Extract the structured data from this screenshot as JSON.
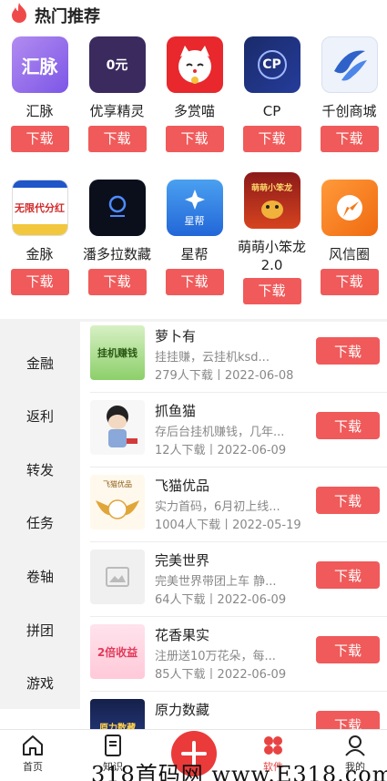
{
  "header": {
    "title": "热门推荐"
  },
  "apps": [
    {
      "name": "汇脉",
      "button": "下载",
      "icon_text": "汇脉"
    },
    {
      "name": "优享精灵",
      "button": "下载",
      "icon_text": "0元"
    },
    {
      "name": "多赏喵",
      "button": "下载",
      "icon_text": ""
    },
    {
      "name": "CP",
      "button": "下载",
      "icon_text": "CP"
    },
    {
      "name": "千创商城",
      "button": "下载",
      "icon_text": ""
    },
    {
      "name": "金脉",
      "button": "下载",
      "icon_text": "无限代分红"
    },
    {
      "name": "潘多拉数藏",
      "button": "下载",
      "icon_text": ""
    },
    {
      "name": "星帮",
      "button": "下载",
      "icon_text": "星帮"
    },
    {
      "name": "萌萌小笨龙2.0",
      "button": "下载",
      "icon_text": "萌萌小笨龙"
    },
    {
      "name": "风信圈",
      "button": "下载",
      "icon_text": ""
    }
  ],
  "side_nav": [
    "金融",
    "返利",
    "转发",
    "任务",
    "卷轴",
    "拼团",
    "游戏"
  ],
  "list": [
    {
      "title": "萝卜有",
      "desc": "挂挂赚，云挂机ksd...",
      "meta": "279人下载丨2022-06-08",
      "button": "下载",
      "thumb_text": "挂机赚钱"
    },
    {
      "title": "抓鱼猫",
      "desc": "存后台挂机赚钱，几年...",
      "meta": "12人下载丨2022-06-09",
      "button": "下载",
      "thumb_text": ""
    },
    {
      "title": "飞猫优品",
      "desc": "实力首码，6月初上线...",
      "meta": "1004人下载丨2022-05-19",
      "button": "下载",
      "thumb_text": "飞猫优品"
    },
    {
      "title": "完美世界",
      "desc": "完美世界带团上车 静...",
      "meta": "64人下载丨2022-06-09",
      "button": "下载",
      "thumb_text": ""
    },
    {
      "title": "花香果实",
      "desc": "注册送10万花朵，每...",
      "meta": "85人下载丨2022-06-09",
      "button": "下载",
      "thumb_text": "2倍收益"
    },
    {
      "title": "原力数藏",
      "desc": "",
      "meta": "",
      "button": "下载",
      "thumb_text": "原力数藏"
    }
  ],
  "tabbar": {
    "home": "首页",
    "know": "知识",
    "soft": "软件",
    "mine": "我的"
  },
  "watermark": "318首码网 www.E318.com",
  "colors": {
    "accent": "#f05a5a",
    "tab_active": "#e84343"
  }
}
